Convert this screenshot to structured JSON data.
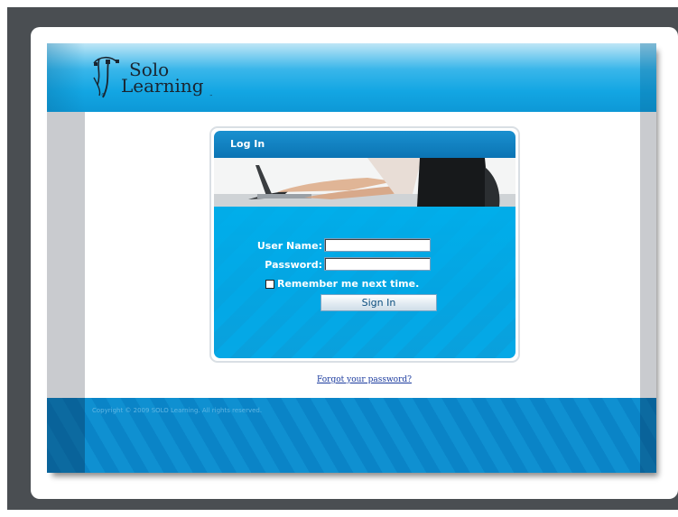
{
  "header": {
    "logo_line1": "Solo",
    "logo_line2": "Learning",
    "logo_tm": "™",
    "logo_r": "®"
  },
  "login_panel": {
    "title": "Log In",
    "username_label": "User Name:",
    "username_value": "",
    "password_label": "Password:",
    "password_value": "",
    "remember_label": "Remember me next time.",
    "remember_checked": false,
    "signin_label": "Sign In"
  },
  "forgot_link": "Forgot your password?",
  "footer": {
    "copyright": "Copyright © 2009 SOLO Learning. All rights reserved."
  },
  "colors": {
    "background": "#4a4e52",
    "header_blue": "#13a6e3",
    "panel_title": "#0b74b4",
    "form_blue": "#05a8e6",
    "footer_blue": "#0a84c7"
  }
}
